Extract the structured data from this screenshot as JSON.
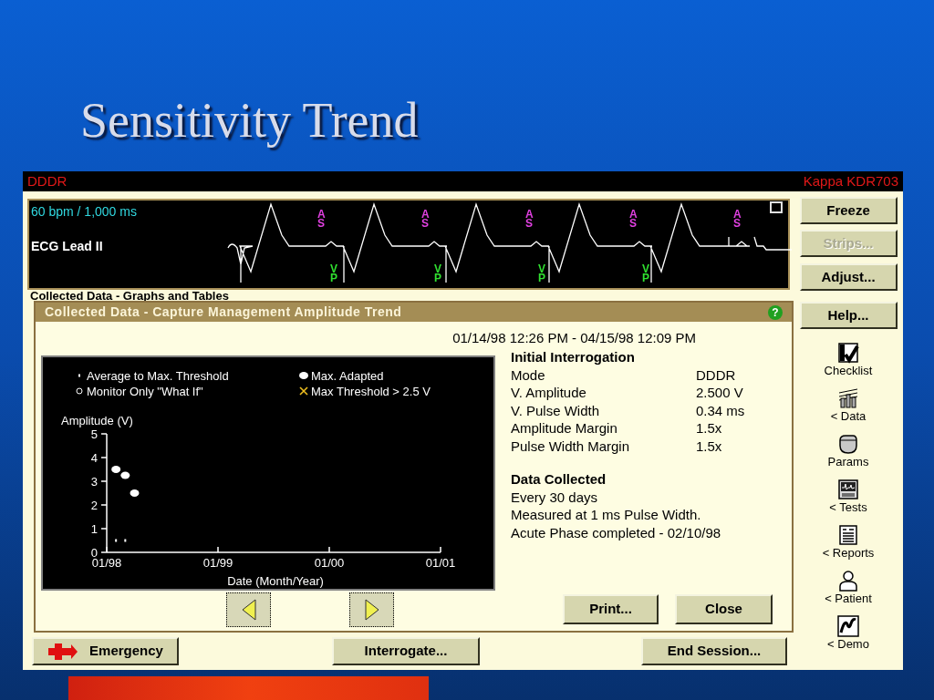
{
  "slide": {
    "title": "Sensitivity Trend"
  },
  "status_bar": {
    "mode": "DDDR",
    "device": "Kappa KDR703"
  },
  "ecg": {
    "rate": "60 bpm / 1,000 ms",
    "lead": "ECG Lead II",
    "atrial_markers": [
      "AS",
      "AS",
      "AS",
      "AS",
      "AS"
    ],
    "ventricular_markers": [
      "VP",
      "VP",
      "VP",
      "VP"
    ]
  },
  "side_buttons": [
    {
      "label": "Freeze",
      "disabled": false
    },
    {
      "label": "Strips...",
      "disabled": true
    },
    {
      "label": "Adjust...",
      "disabled": false
    },
    {
      "label": "Help...",
      "disabled": false
    }
  ],
  "nav": [
    {
      "kind": "checklist",
      "label": "Checklist"
    },
    {
      "kind": "data",
      "label": "< Data"
    },
    {
      "kind": "params",
      "label": "Params"
    },
    {
      "kind": "tests",
      "label": "< Tests"
    },
    {
      "kind": "reports",
      "label": "< Reports"
    },
    {
      "kind": "patient",
      "label": "< Patient"
    },
    {
      "kind": "demo",
      "label": "< Demo"
    }
  ],
  "background_tab": {
    "label": "Collected Data - Graphs and Tables"
  },
  "dialog": {
    "title": "Collected Data - Capture Management Amplitude Trend",
    "help": "?",
    "date_range": "01/14/98 12:26 PM - 04/15/98 12:09 PM",
    "chart_data": {
      "type": "scatter",
      "xlabel": "Date (Month/Year)",
      "ylabel": "Amplitude (V)",
      "categories": [
        "01/98",
        null,
        null,
        null,
        null,
        null,
        null,
        null,
        null,
        null,
        null,
        null,
        "01/99",
        null,
        null,
        null,
        null,
        null,
        null,
        null,
        null,
        null,
        null,
        null,
        "01/00",
        null,
        null,
        null,
        null,
        null,
        null,
        null,
        null,
        null,
        null,
        null,
        "01/01"
      ],
      "series": [
        {
          "name": "Average to Max. Threshold",
          "marker": "square",
          "color": "#ffffff",
          "values": [
            null,
            0.5,
            0.5,
            null,
            null,
            null,
            null,
            null,
            null,
            null,
            null,
            null,
            null,
            null,
            null,
            null,
            null,
            null,
            null,
            null,
            null,
            null,
            null,
            null,
            null,
            null,
            null,
            null,
            null,
            null,
            null,
            null,
            null,
            null,
            null,
            null,
            null
          ]
        },
        {
          "name": "Max. Adapted",
          "marker": "circle",
          "color": "#ffffff",
          "values": [
            null,
            3.5,
            3.25,
            2.5,
            null,
            null,
            null,
            null,
            null,
            null,
            null,
            null,
            null,
            null,
            null,
            null,
            null,
            null,
            null,
            null,
            null,
            null,
            null,
            null,
            null,
            null,
            null,
            null,
            null,
            null,
            null,
            null,
            null,
            null,
            null,
            null,
            null
          ]
        },
        {
          "name": "Monitor Only \"What If\"",
          "marker": "circle",
          "color": "#ffffff",
          "values": [
            null,
            null,
            null,
            null,
            null,
            null,
            null,
            null,
            null,
            null,
            null,
            null,
            null,
            null,
            null,
            null,
            null,
            null,
            null,
            null,
            null,
            null,
            null,
            null,
            null,
            null,
            null,
            null,
            null,
            null,
            null,
            null,
            null,
            null,
            null,
            null,
            null
          ]
        },
        {
          "name": "Max Threshold > 2.5 V",
          "marker": "cross",
          "color": "#f0c020",
          "values": [
            null,
            null,
            null,
            null,
            null,
            null,
            null,
            null,
            null,
            null,
            null,
            null,
            null,
            null,
            null,
            null,
            null,
            null,
            null,
            null,
            null,
            null,
            null,
            null,
            null,
            null,
            null,
            null,
            null,
            null,
            null,
            null,
            null,
            null,
            null,
            null,
            null
          ]
        }
      ],
      "ylim": [
        0,
        5
      ],
      "legend": "top",
      "yticks": [
        0,
        1,
        2,
        3,
        4,
        5
      ]
    },
    "initial": {
      "heading": "Initial Interrogation",
      "rows": [
        {
          "label": "Mode",
          "value": "DDDR"
        },
        {
          "label": "V. Amplitude",
          "value": "2.500 V"
        },
        {
          "label": "V. Pulse Width",
          "value": "0.34 ms"
        },
        {
          "label": "Amplitude Margin",
          "value": "1.5x"
        },
        {
          "label": "Pulse Width Margin",
          "value": "1.5x"
        }
      ]
    },
    "collected": {
      "heading": "Data Collected",
      "lines": [
        "Every 30 days",
        "Measured at 1 ms Pulse Width.",
        "Acute Phase completed - 02/10/98"
      ]
    },
    "buttons": [
      "Print...",
      "Close"
    ]
  },
  "bottom_buttons": [
    {
      "kind": "emergency",
      "label": "Emergency"
    },
    {
      "kind": "plain",
      "label": "Interrogate..."
    },
    {
      "kind": "plain",
      "label": "End Session..."
    }
  ]
}
